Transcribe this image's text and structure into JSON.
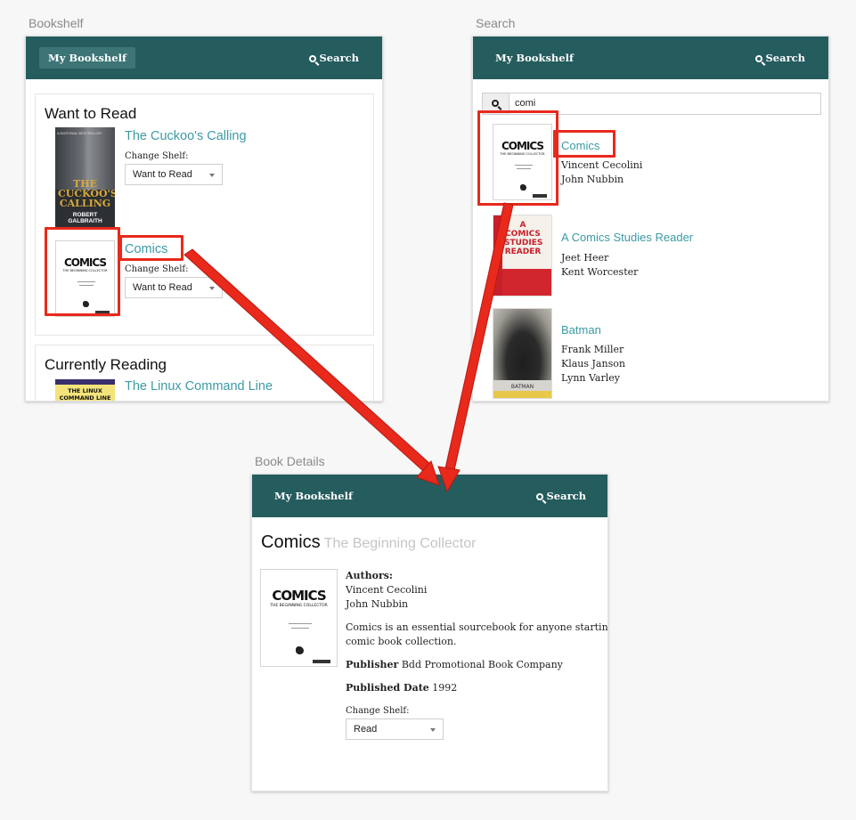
{
  "labels": {
    "bookshelf": "Bookshelf",
    "search": "Search",
    "details": "Book Details"
  },
  "nav": {
    "home": "My Bookshelf",
    "search": "Search"
  },
  "bookshelf": {
    "want_to_read": {
      "title": "Want to Read",
      "books": [
        {
          "title": "The Cuckoo's Calling",
          "change_label": "Change Shelf:",
          "shelf": "Want to Read"
        },
        {
          "title": "Comics",
          "change_label": "Change Shelf:",
          "shelf": "Want to Read"
        }
      ]
    },
    "currently_reading": {
      "title": "Currently Reading",
      "books": [
        {
          "title": "The Linux Command Line"
        }
      ]
    }
  },
  "covers": {
    "cuckoo": {
      "top": "A NATIONAL BESTSELLER",
      "title": "THE CUCKOO'S CALLING",
      "author": "ROBERT GALBRAITH"
    },
    "comics": {
      "logo": "COMICS",
      "sub": "THE BEGINNING COLLECTOR"
    },
    "studies": {
      "title": "A COMICS STUDIES READER"
    },
    "batman": {
      "title": "BATMAN"
    },
    "linux": {
      "title": "THE LINUX COMMAND LINE"
    }
  },
  "search": {
    "query": "comi",
    "results": [
      {
        "title": "Comics",
        "authors": [
          "Vincent Cecolini",
          "John Nubbin"
        ]
      },
      {
        "title": "A Comics Studies Reader",
        "authors": [
          "Jeet Heer",
          "Kent Worcester"
        ]
      },
      {
        "title": "Batman",
        "authors": [
          "Frank Miller",
          "Klaus Janson",
          "Lynn Varley"
        ]
      }
    ]
  },
  "details": {
    "title": "Comics",
    "subtitle": "The Beginning Collector",
    "authors_label": "Authors:",
    "authors": [
      "Vincent Cecolini",
      "John Nubbin"
    ],
    "description_1": "Comics is an essential sourcebook for anyone starting a",
    "description_2": "comic book collection.",
    "publisher_label": "Publisher",
    "publisher": "Bdd Promotional Book Company",
    "published_label": "Published Date",
    "published": "1992",
    "change_label": "Change Shelf:",
    "shelf": "Read"
  },
  "colors": {
    "nav": "#255c5e",
    "link": "#3b9aa5",
    "highlight": "#e8291c"
  }
}
